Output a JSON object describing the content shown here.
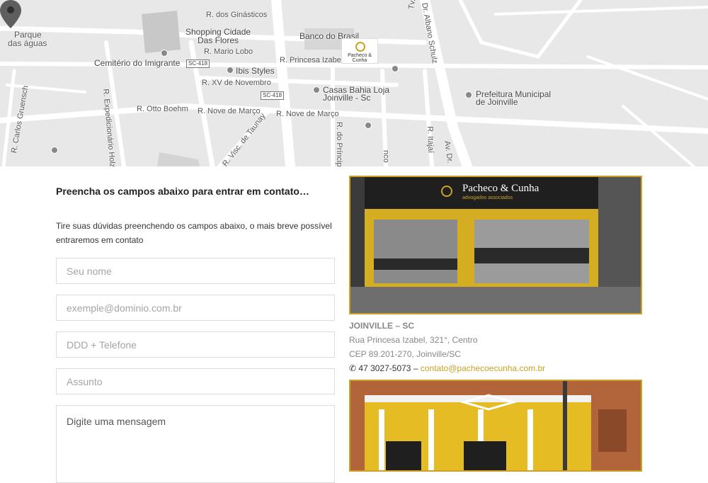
{
  "map": {
    "labels": {
      "ginasticos": "R. dos Ginásticos",
      "parque": "Parque",
      "das_aguas": "das águas",
      "shopping1": "Shopping Cidade",
      "shopping2": "Das Flores",
      "mario_lobo": "R. Mario Lobo",
      "banco": "Banco do Brasil",
      "cemiterio": "Cemitério do Imigrante",
      "ibis": "Ibis Styles",
      "princesa": "R. Princesa Izabel",
      "xv": "R. XV de Novembro",
      "casas1": "Casas Bahia Loja",
      "casas2": "Joinville - Sc",
      "prefeitura1": "Prefeitura Municipal",
      "prefeitura2": "de Joinville",
      "otto": "R. Otto Boehm",
      "nove1": "R. Nove de Março",
      "nove2": "R. Nove de Março",
      "gruensch": "R. Carlos Gruensch",
      "expedicionario": "R. Expedicionário Holz",
      "taunay": "R. Visc. de Taunay",
      "principe": "R. do Príncipe",
      "albano": "Dr. Albano Schulz",
      "itajai": "R. Itajaí",
      "av_dr": "Av. Dr.",
      "tv": "Tv. Ch",
      "nco": "nco",
      "sc1": "SC-418",
      "sc2": "SC-418"
    },
    "marker_brand": "Pacheco & Cunha"
  },
  "form": {
    "heading": "Preencha os campos abaixo para entrar em contato…",
    "intro": "Tire suas dúvidas preenchendo os campos abaixo, o mais breve possível entraremos em contato",
    "name_placeholder": "Seu nome",
    "email_placeholder": "exemple@dominio.com.br",
    "phone_placeholder": "DDD + Telefone",
    "subject_placeholder": "Assunto",
    "message_placeholder": "Digite uma mensagem"
  },
  "office": {
    "sign_title": "Pacheco & Cunha",
    "sign_subtitle": "advogados associados",
    "city": "JOINVILLE – SC",
    "street": "Rua Princesa Izabel, 321°, Centro",
    "cep": "CEP 89.201-270, Joinville/SC",
    "phone": "47 3027-5073",
    "separator": "–",
    "email": "contato@pachecoecunha.com.br"
  },
  "colors": {
    "accent": "#c9a227",
    "map_bg": "#e8e8e8"
  }
}
